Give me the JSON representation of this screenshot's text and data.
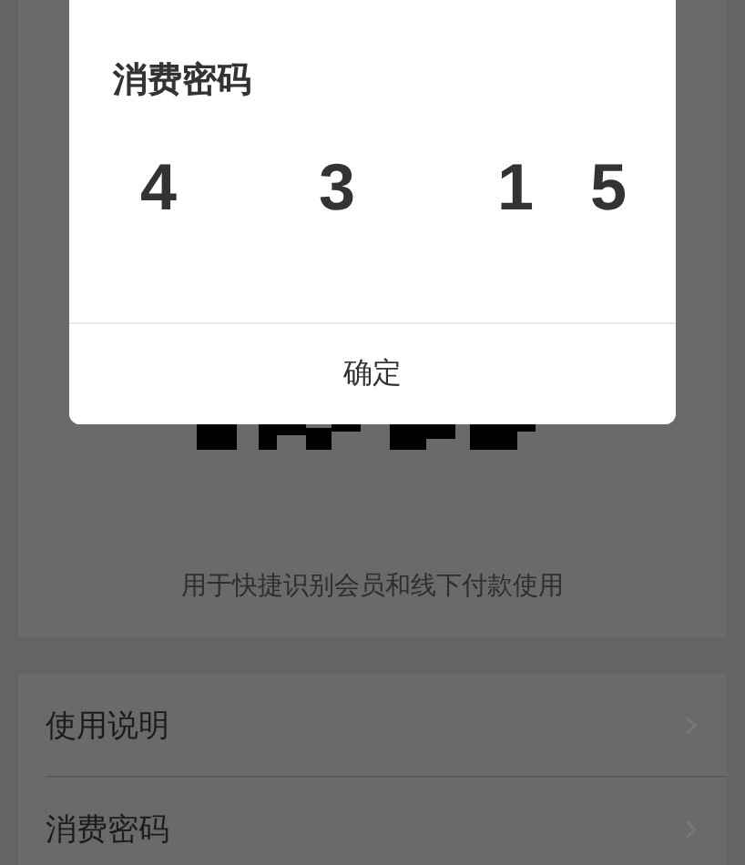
{
  "page": {
    "caption": "用于快捷识别会员和线下付款使用",
    "menu": [
      {
        "label": "使用说明"
      },
      {
        "label": "消费密码"
      }
    ]
  },
  "dialog": {
    "title": "消费密码",
    "digits": [
      "4",
      "3",
      "1",
      "5"
    ],
    "button": "确定"
  }
}
